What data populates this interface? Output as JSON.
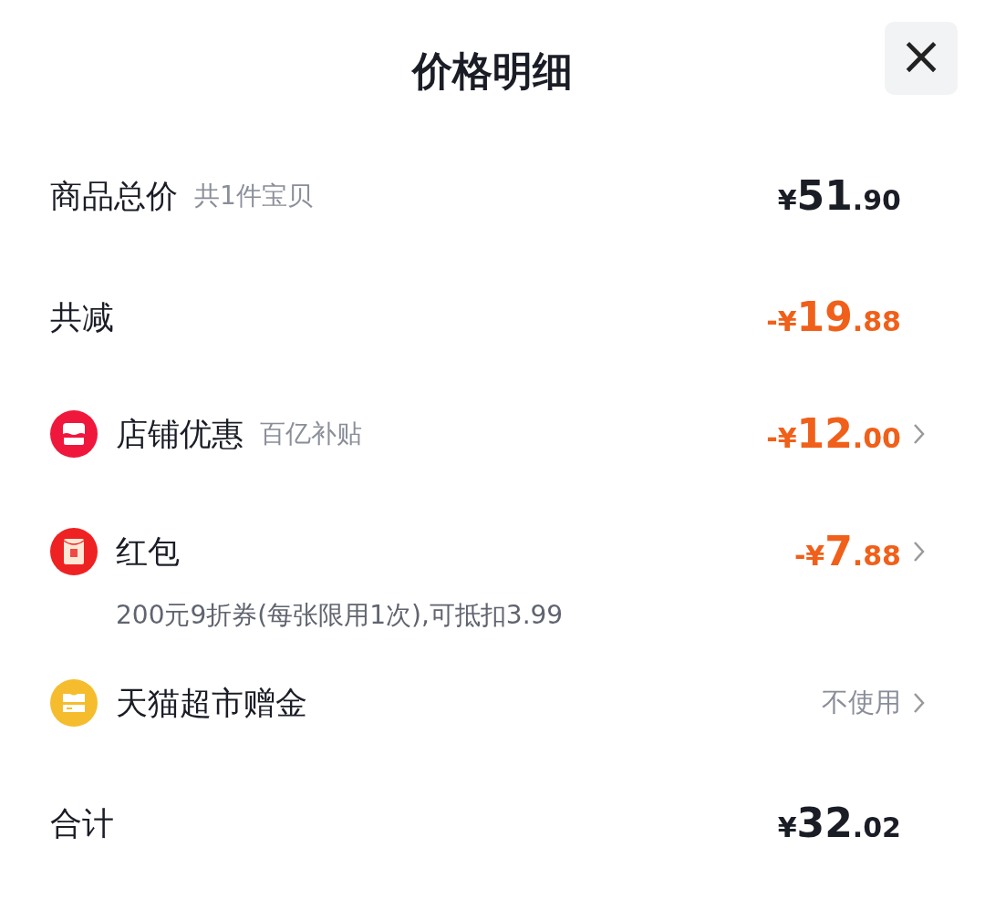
{
  "title": "价格明细",
  "close": {
    "label": "×"
  },
  "rows": [
    {
      "kind": "plain",
      "label": "商品总价",
      "sub": "共1件宝贝",
      "amount": {
        "negative": false,
        "prefix": "¥",
        "main": "51",
        "fraction": ".90"
      }
    },
    {
      "kind": "plain",
      "label": "共减",
      "amount": {
        "negative": true,
        "prefix": "-¥",
        "main": "19",
        "fraction": ".88"
      }
    },
    {
      "kind": "shop",
      "color": "#f0173c",
      "label": "店铺优惠",
      "sub": "百亿补贴",
      "amount": {
        "negative": true,
        "prefix": "-¥",
        "main": "12",
        "fraction": ".00"
      }
    },
    {
      "kind": "envelope",
      "color": "#ee2222",
      "label": "红包",
      "note": "200元9折券(每张限用1次),可抵扣3.99",
      "amount": {
        "negative": true,
        "prefix": "-¥",
        "main": "7",
        "fraction": ".88"
      }
    },
    {
      "kind": "card",
      "color": "#f5bd2e",
      "label": "天猫超市赠金",
      "status": "不使用"
    },
    {
      "kind": "plain",
      "label": "合计",
      "amount": {
        "negative": false,
        "prefix": "¥",
        "main": "32",
        "fraction": ".02"
      }
    }
  ]
}
